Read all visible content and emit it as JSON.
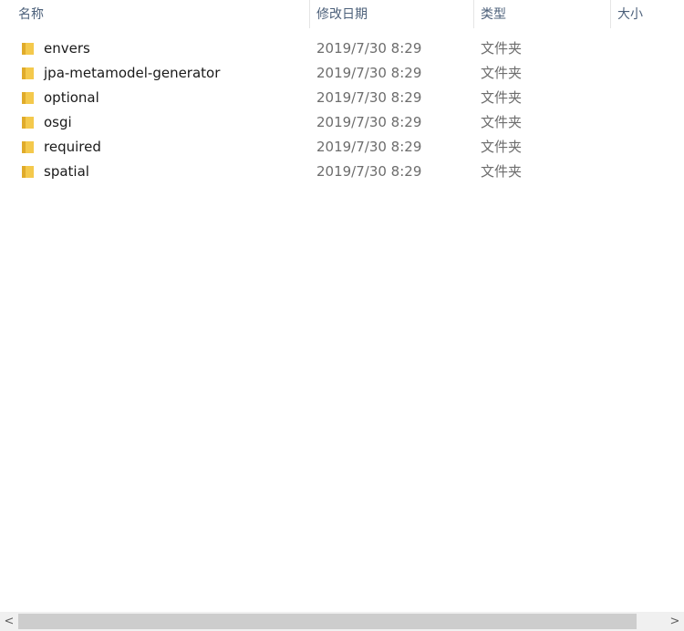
{
  "columns": {
    "name": "名称",
    "date_modified": "修改日期",
    "type": "类型",
    "size": "大小",
    "sort_indicator": "^"
  },
  "files": [
    {
      "name": "envers",
      "date": "2019/7/30 8:29",
      "type": "文件夹"
    },
    {
      "name": "jpa-metamodel-generator",
      "date": "2019/7/30 8:29",
      "type": "文件夹"
    },
    {
      "name": "optional",
      "date": "2019/7/30 8:29",
      "type": "文件夹"
    },
    {
      "name": "osgi",
      "date": "2019/7/30 8:29",
      "type": "文件夹"
    },
    {
      "name": "required",
      "date": "2019/7/30 8:29",
      "type": "文件夹"
    },
    {
      "name": "spatial",
      "date": "2019/7/30 8:29",
      "type": "文件夹"
    }
  ],
  "scrollbar": {
    "left_arrow": "<",
    "right_arrow": ">"
  },
  "colors": {
    "folder_body": "#f4c94c",
    "folder_tab": "#e0ab2a",
    "header_text": "#4c607a",
    "muted_text": "#6d6d6d"
  }
}
